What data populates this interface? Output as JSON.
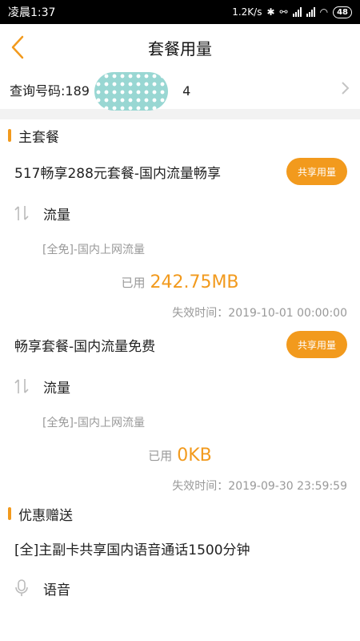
{
  "statusbar": {
    "time": "凌晨1:37",
    "speed": "1.2K/s",
    "battery": "48"
  },
  "header": {
    "title": "套餐用量",
    "icon_back": "chevron-left-icon"
  },
  "query": {
    "label": "查询号码:189",
    "tail": "4"
  },
  "main_package": {
    "section_title": "主套餐",
    "plans": [
      {
        "name": "517畅享288元套餐-国内流量畅享",
        "share_label": "共享用量",
        "item_label": "流量",
        "item_sub": "[全免]-国内上网流量",
        "used_label": "已用",
        "used_value": "242.75MB",
        "expire": "失效时间：2019-10-01 00:00:00"
      },
      {
        "name": "畅享套餐-国内流量免费",
        "share_label": "共享用量",
        "item_label": "流量",
        "item_sub": "[全免]-国内上网流量",
        "used_label": "已用",
        "used_value": "0KB",
        "expire": "失效时间：2019-09-30 23:59:59"
      }
    ]
  },
  "benefits": {
    "section_title": "优惠赠送",
    "item_name": "[全]主副卡共享国内语音通话1500分钟",
    "item_label": "语音"
  },
  "colors": {
    "accent": "#f29a1d",
    "muted": "#999999"
  }
}
